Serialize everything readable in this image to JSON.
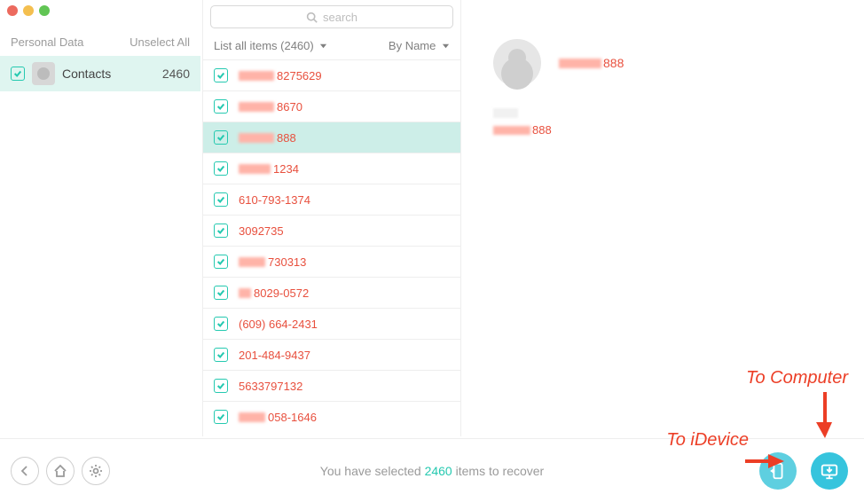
{
  "sidebar": {
    "header": "Personal Data",
    "action": "Unselect All",
    "category": {
      "label": "Contacts",
      "count": "2460"
    }
  },
  "search": {
    "placeholder": "search"
  },
  "list": {
    "filter_label": "List all items (2460)",
    "sort_label": "By Name",
    "items": [
      {
        "blur_w": 40,
        "suffix": "8275629",
        "selected": false
      },
      {
        "blur_w": 40,
        "suffix": "8670",
        "selected": false
      },
      {
        "blur_w": 40,
        "suffix": "888",
        "selected": true
      },
      {
        "blur_w": 36,
        "suffix": "1234",
        "selected": false
      },
      {
        "blur_w": 0,
        "suffix": "610-793-1374",
        "selected": false
      },
      {
        "blur_w": 0,
        "suffix": "3092735",
        "selected": false
      },
      {
        "blur_w": 30,
        "suffix": "730313",
        "selected": false
      },
      {
        "blur_w": 14,
        "suffix": "8029-0572",
        "selected": false
      },
      {
        "blur_w": 0,
        "suffix": "(609) 664-2431",
        "selected": false
      },
      {
        "blur_w": 0,
        "suffix": "201-484-9437",
        "selected": false
      },
      {
        "blur_w": 0,
        "suffix": "5633797132",
        "selected": false
      },
      {
        "blur_w": 30,
        "suffix": "058-1646",
        "selected": false
      }
    ]
  },
  "detail": {
    "name_suffix": "888",
    "phone_suffix": "888"
  },
  "footer": {
    "status_pre": "You have selected ",
    "status_num": "2460",
    "status_post": " items to recover"
  },
  "annotations": {
    "to_idevice": "To iDevice",
    "to_computer": "To Computer"
  }
}
